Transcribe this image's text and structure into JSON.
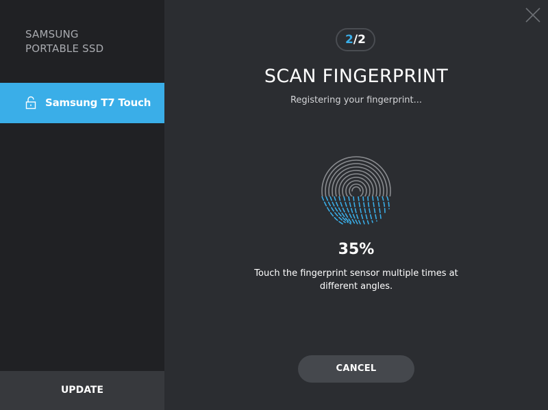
{
  "sidebar": {
    "brand_line1": "SAMSUNG",
    "brand_line2": "PORTABLE SSD",
    "device_label": "Samsung T7 Touch",
    "device_icon": "unlocked-padlock-icon",
    "update_label": "UPDATE"
  },
  "main": {
    "step_current": "2",
    "step_sep": "/",
    "step_total": "2",
    "title": "SCAN FINGERPRINT",
    "subtitle": "Registering your fingerprint...",
    "progress_percent": "35%",
    "progress_value": 0.35,
    "instruction": "Touch the fingerprint sensor multiple times at different angles.",
    "cancel_label": "CANCEL",
    "close_icon": "close-icon"
  },
  "colors": {
    "accent": "#3aaee8",
    "sidebar_bg": "#202124",
    "main_bg": "#2b2d31",
    "button_bg": "#45484d"
  }
}
